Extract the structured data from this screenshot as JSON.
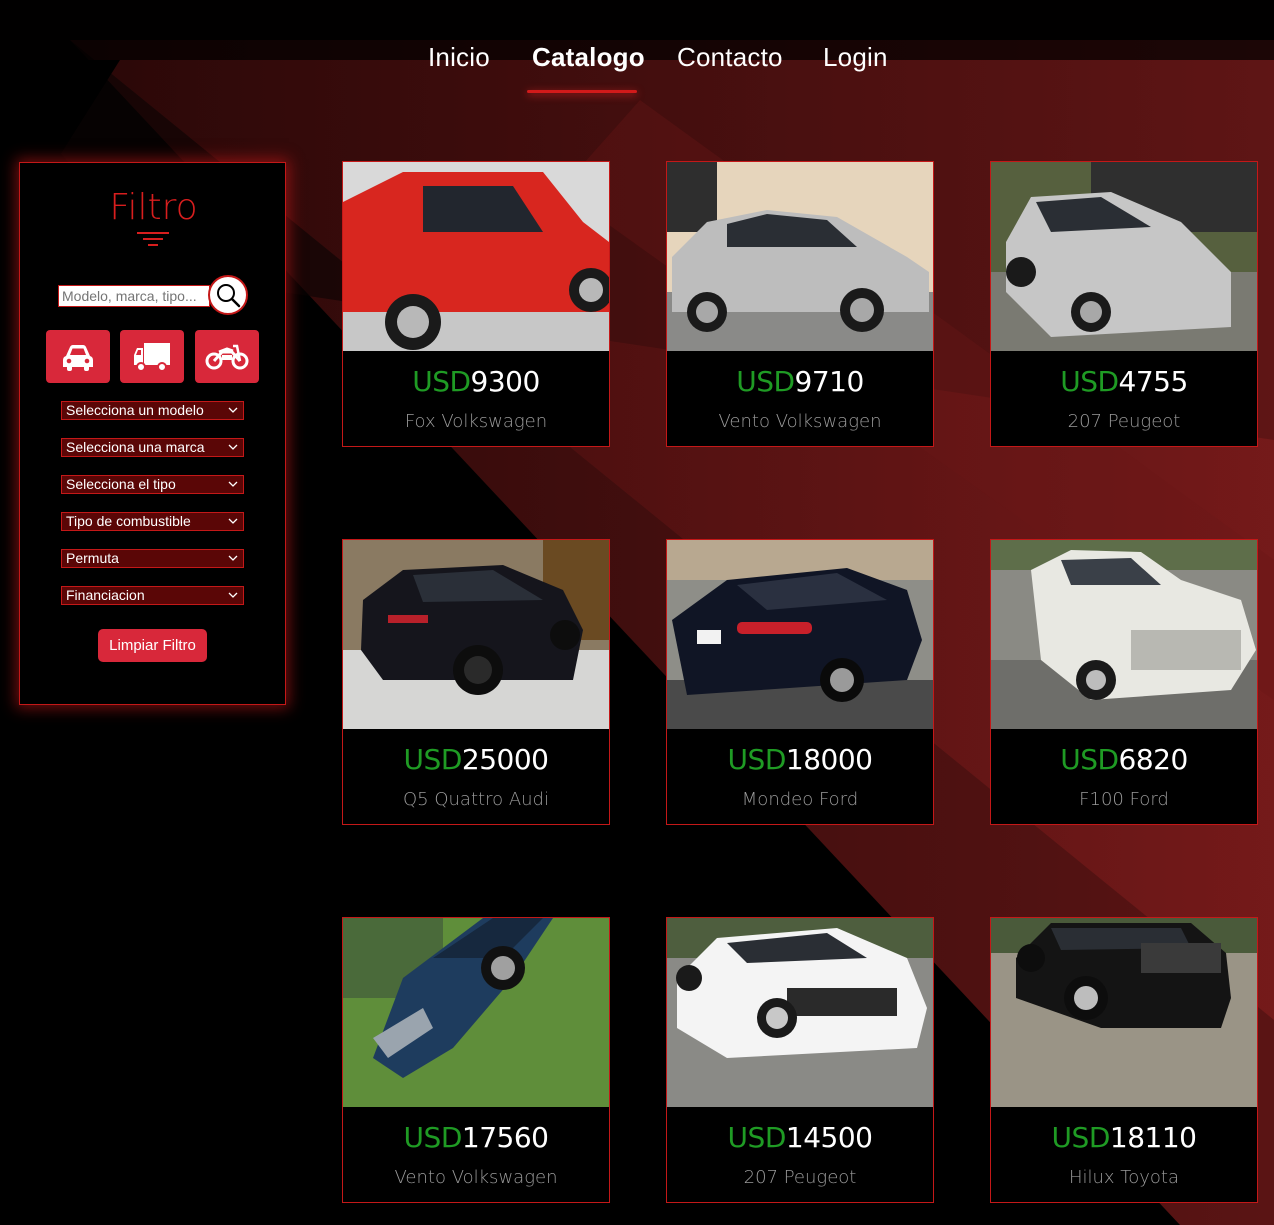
{
  "nav": {
    "items": [
      {
        "label": "Inicio",
        "active": false
      },
      {
        "label": "Catalogo",
        "active": true
      },
      {
        "label": "Contacto",
        "active": false
      },
      {
        "label": "Login",
        "active": false
      }
    ]
  },
  "filter": {
    "title": "Filtro",
    "title_icon": "menu-lines-icon",
    "search_placeholder": "Modelo, marca, tipo...",
    "search_icon": "search-icon",
    "vehicle_types": [
      {
        "icon": "car-icon"
      },
      {
        "icon": "truck-icon"
      },
      {
        "icon": "motorcycle-icon"
      }
    ],
    "selects": [
      {
        "label": "Selecciona un modelo"
      },
      {
        "label": "Selecciona una marca"
      },
      {
        "label": "Selecciona el tipo"
      },
      {
        "label": "Tipo de combustible"
      },
      {
        "label": "Permuta"
      },
      {
        "label": "Financiacion"
      }
    ],
    "clear_label": "Limpiar Filtro"
  },
  "colors": {
    "accent": "#d8283a",
    "border": "#c41818",
    "price_currency": "#1f9b24"
  },
  "catalog": {
    "currency": "USD",
    "cars": [
      {
        "price": "9300",
        "name": "Fox Volkswagen",
        "color": "#d8261f",
        "bg": "#dcdcdc"
      },
      {
        "price": "9710",
        "name": "Vento Volkswagen",
        "color": "#bcbcbc",
        "bg": "#e8d8c0"
      },
      {
        "price": "4755",
        "name": "207 Peugeot",
        "color": "#c8c8c8",
        "bg": "#6e7a5c"
      },
      {
        "price": "25000",
        "name": "Q5 Quattro Audi",
        "color": "#15151c",
        "bg": "#8a7a62"
      },
      {
        "price": "18000",
        "name": "Mondeo Ford",
        "color": "#101525",
        "bg": "#8e8e88"
      },
      {
        "price": "6820",
        "name": "F100 Ford",
        "color": "#e8e8e2",
        "bg": "#8a8a84"
      },
      {
        "price": "17560",
        "name": "Vento Volkswagen",
        "color": "#1e3c5e",
        "bg": "#5f8e3a"
      },
      {
        "price": "14500",
        "name": "207 Peugeot",
        "color": "#f4f4f4",
        "bg": "#8a8a86"
      },
      {
        "price": "18110",
        "name": "Hilux Toyota",
        "color": "#141414",
        "bg": "#9a9486"
      }
    ]
  }
}
